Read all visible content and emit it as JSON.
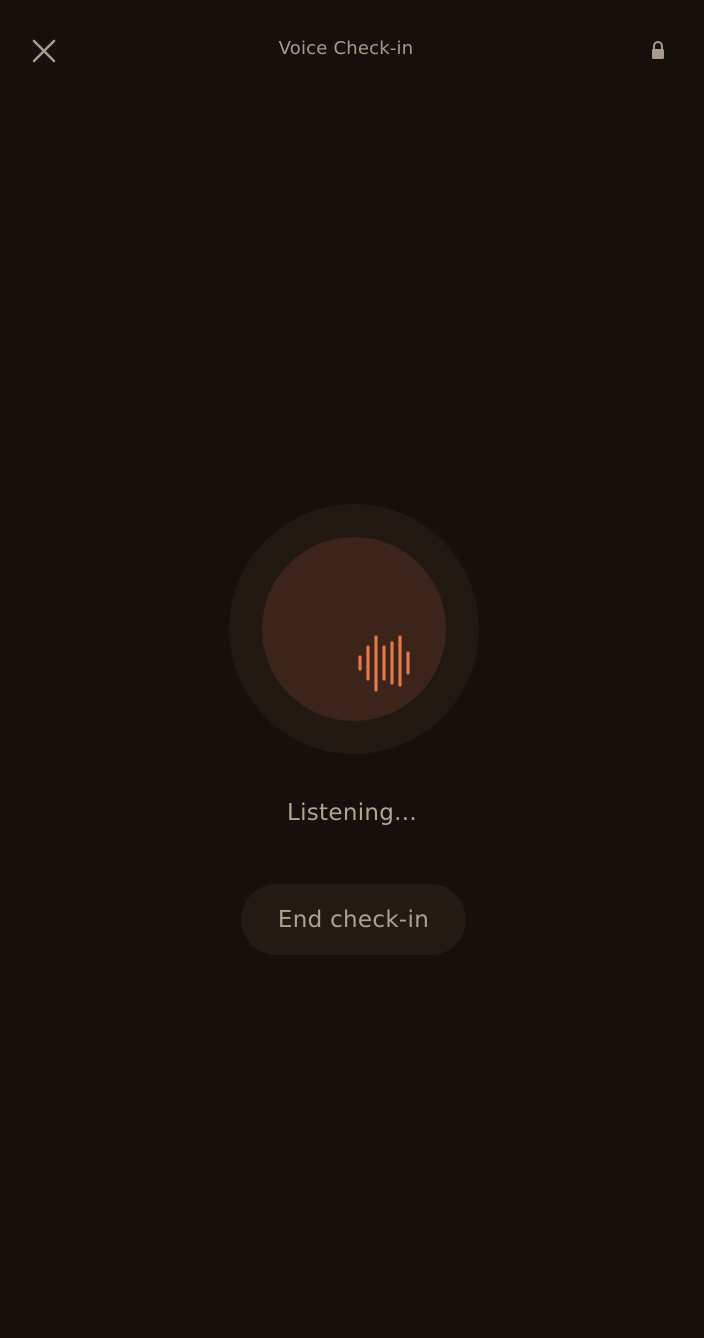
{
  "header": {
    "title": "Voice Check-in",
    "close_icon": "close-icon",
    "lock_icon": "lock-icon"
  },
  "voice": {
    "icon": "audio-waveform-icon",
    "status": "Listening..."
  },
  "actions": {
    "end_label": "End check-in"
  },
  "colors": {
    "background": "#15100c",
    "accent": "#e2774a",
    "text_muted": "#a89b8c"
  }
}
